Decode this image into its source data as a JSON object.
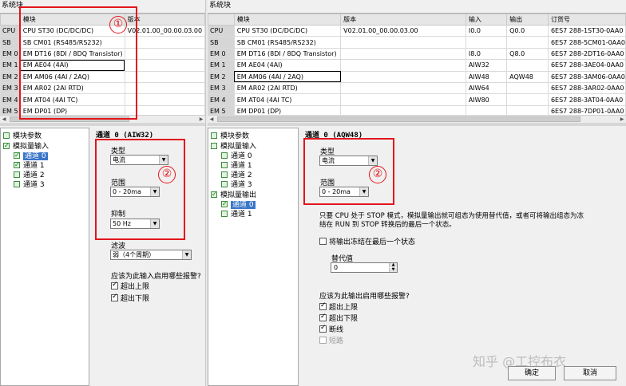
{
  "window_title": "系统块",
  "grid": {
    "headers": [
      "",
      "模块",
      "版本",
      "输入",
      "输出",
      "订货号"
    ],
    "rows": [
      {
        "slot": "CPU",
        "module": "CPU ST30 (DC/DC/DC)",
        "version": "V02.01.00_00.00.03.00",
        "input": "I0.0",
        "output": "Q0.0",
        "order": "6ES7 288-1ST30-0AA0"
      },
      {
        "slot": "SB",
        "module": "SB CM01 (RS485/RS232)",
        "version": "",
        "input": "",
        "output": "",
        "order": "6ES7 288-5CM01-0AA0"
      },
      {
        "slot": "EM 0",
        "module": "EM DT16 (8DI / 8DQ Transistor)",
        "version": "",
        "input": "I8.0",
        "output": "Q8.0",
        "order": "6ES7 288-2DT16-0AA0"
      },
      {
        "slot": "EM 1",
        "module": "EM AE04 (4AI)",
        "version": "",
        "input": "AIW32",
        "output": "",
        "order": "6ES7 288-3AE04-0AA0"
      },
      {
        "slot": "EM 2",
        "module": "EM AM06 (4AI / 2AQ)",
        "version": "",
        "input": "AIW48",
        "output": "AQW48",
        "order": "6ES7 288-3AM06-0AA0"
      },
      {
        "slot": "EM 3",
        "module": "EM AR02 (2AI RTD)",
        "version": "",
        "input": "AIW64",
        "output": "",
        "order": "6ES7 288-3AR02-0AA0"
      },
      {
        "slot": "EM 4",
        "module": "EM AT04 (4AI TC)",
        "version": "",
        "input": "AIW80",
        "output": "",
        "order": "6ES7 288-3AT04-0AA0"
      },
      {
        "slot": "EM 5",
        "module": "EM DP01 (DP)",
        "version": "",
        "input": "",
        "output": "",
        "order": "6ES7 288-7DP01-0AA0"
      }
    ]
  },
  "annotations": {
    "one": "①",
    "two": "②"
  },
  "left_panel": {
    "tree": {
      "module_params": "模块参数",
      "analog_input": "模拟量输入",
      "channels": [
        "通道 0",
        "通道 1",
        "通道 2",
        "通道 3"
      ]
    },
    "title": "通道 0 (AIW32)",
    "type_label": "类型",
    "type_value": "电流",
    "range_label": "范围",
    "range_value": "0 - 20ma",
    "suppress_label": "抑制",
    "suppress_value": "50 Hz",
    "filter_label": "滤波",
    "filter_value": "弱（4个周期）",
    "alarm_question": "应该为此输入启用哪些报警?",
    "alarms": [
      "超出上限",
      "超出下限"
    ]
  },
  "right_panel": {
    "tree": {
      "module_params": "模块参数",
      "analog_input": "模拟量输入",
      "input_channels": [
        "通道 0",
        "通道 1",
        "通道 2",
        "通道 3"
      ],
      "analog_output": "模拟量输出",
      "output_channels": [
        "通道 0",
        "通道 1"
      ]
    },
    "title": "通道 0 (AQW48)",
    "type_label": "类型",
    "type_value": "电流",
    "range_label": "范围",
    "range_value": "0 - 20ma",
    "note_line1": "只要 CPU 处于 STOP 模式，模拟量输出就可组态为使用替代值，或者可将输出组态为冻",
    "note_line2": "结在 RUN 到 STOP 转换后的最后一个状态。",
    "freeze_label": "将输出冻结在最后一个状态",
    "substitute_label": "替代值",
    "substitute_value": "0",
    "alarm_question": "应该为此输出启用哪些报警?",
    "alarms": [
      "超出上限",
      "超出下限",
      "断线",
      "短路"
    ],
    "ok_button": "确定",
    "cancel_button": "取消"
  },
  "watermark": "知乎 @工控布衣"
}
